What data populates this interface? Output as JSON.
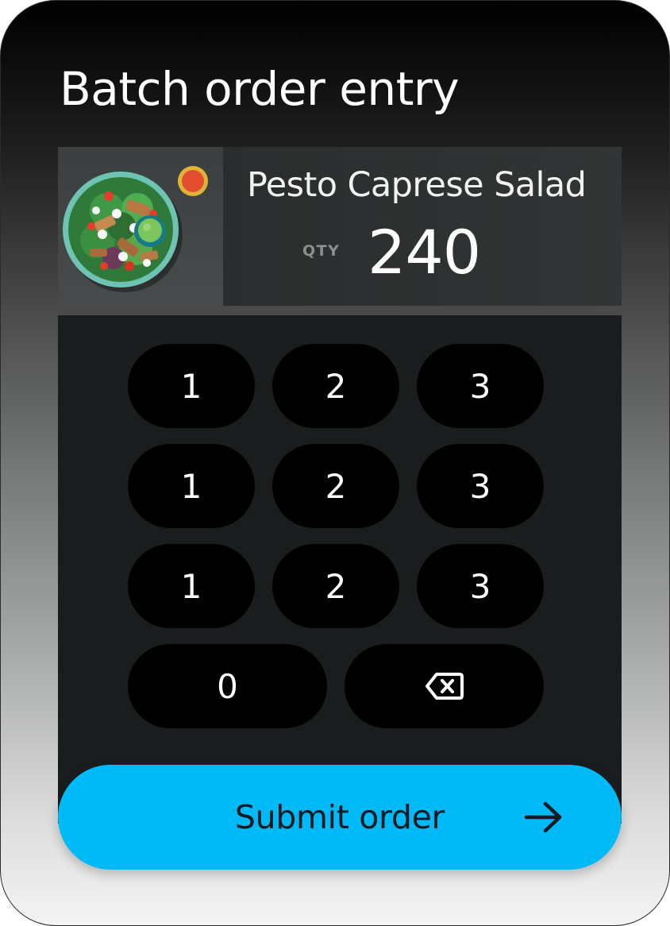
{
  "screen": {
    "title": "Batch order entry"
  },
  "product": {
    "image_icon": "salad-bowl-image",
    "name": "Pesto Caprese Salad",
    "qty_label": "QTY",
    "qty_value": "240"
  },
  "keypad": {
    "rows": [
      [
        "1",
        "2",
        "3"
      ],
      [
        "1",
        "2",
        "3"
      ],
      [
        "1",
        "2",
        "3"
      ]
    ],
    "zero": "0",
    "backspace_icon": "backspace-icon"
  },
  "submit": {
    "label": "Submit order",
    "icon": "arrow-right-icon",
    "color": "#00b9f7"
  },
  "colors": {
    "keypad_bg": "#1a1d1e",
    "key_bg": "#000000",
    "product_bg": "#2e3131"
  }
}
